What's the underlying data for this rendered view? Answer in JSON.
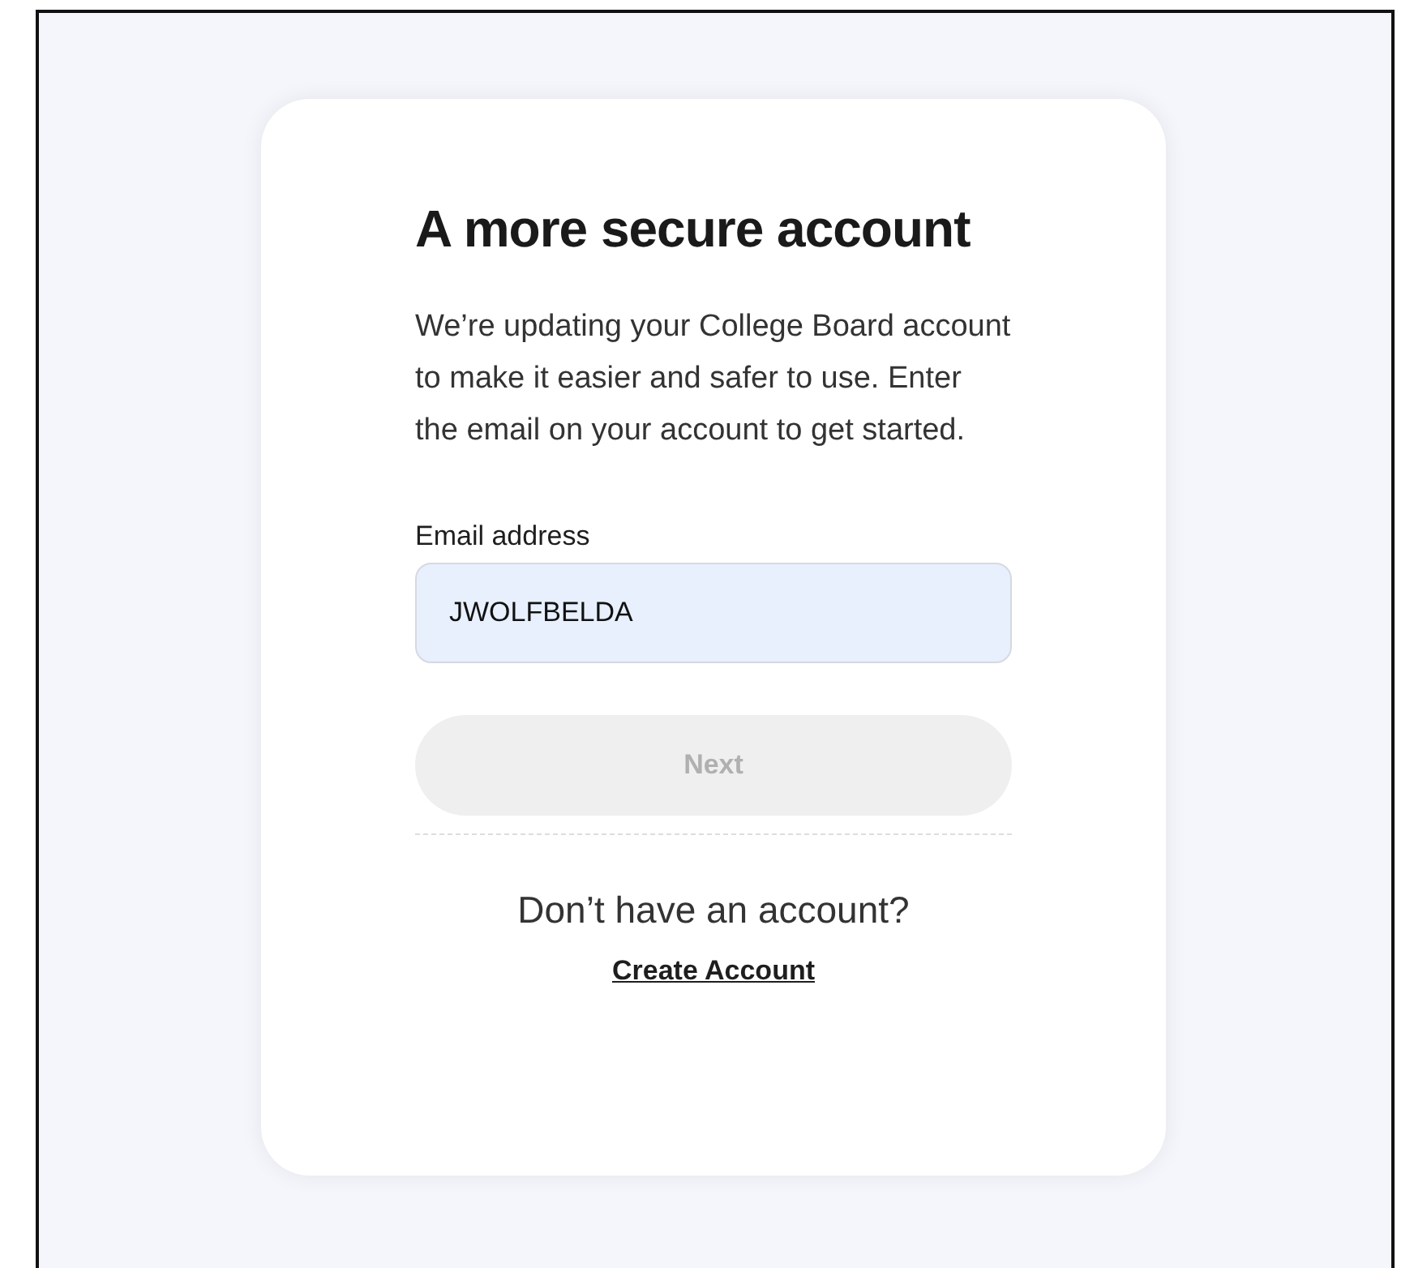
{
  "card": {
    "title": "A more secure account",
    "description": "We’re updating your College Board account to make it easier and safer to use. Enter the email on your account to get started.",
    "email_field": {
      "label": "Email address",
      "value": "JWOLFBELDA"
    },
    "next_button": {
      "label": "Next",
      "disabled": true
    },
    "signup_prompt": "Don’t have an account?",
    "create_account_link": "Create Account"
  }
}
